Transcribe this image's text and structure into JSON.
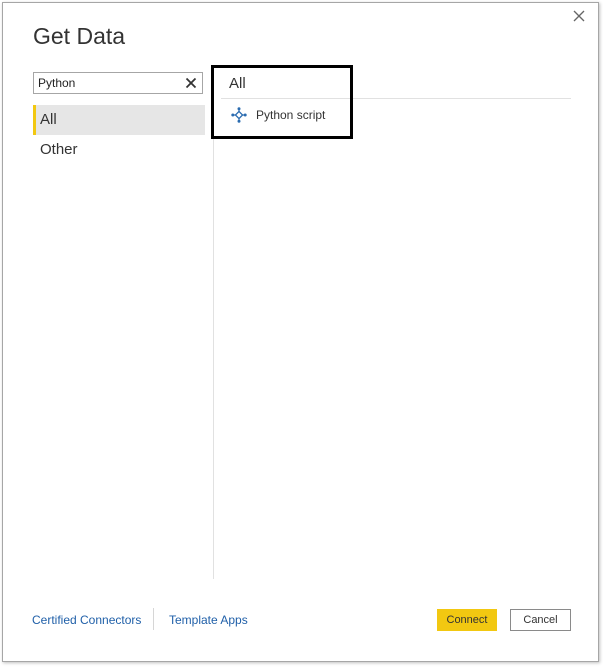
{
  "dialog": {
    "title": "Get Data",
    "close_icon": "close-icon"
  },
  "search": {
    "value": "Python",
    "clear_icon": "clear-icon"
  },
  "categories": [
    {
      "label": "All",
      "selected": true
    },
    {
      "label": "Other",
      "selected": false
    }
  ],
  "results": {
    "header": "All",
    "items": [
      {
        "label": "Python script",
        "icon": "python-script-icon"
      }
    ]
  },
  "footer": {
    "certified_connectors": "Certified Connectors",
    "template_apps": "Template Apps",
    "connect_label": "Connect",
    "cancel_label": "Cancel"
  },
  "colors": {
    "accent": "#f2c811",
    "link": "#1f5fa8",
    "icon_blue": "#2b6cb0"
  }
}
